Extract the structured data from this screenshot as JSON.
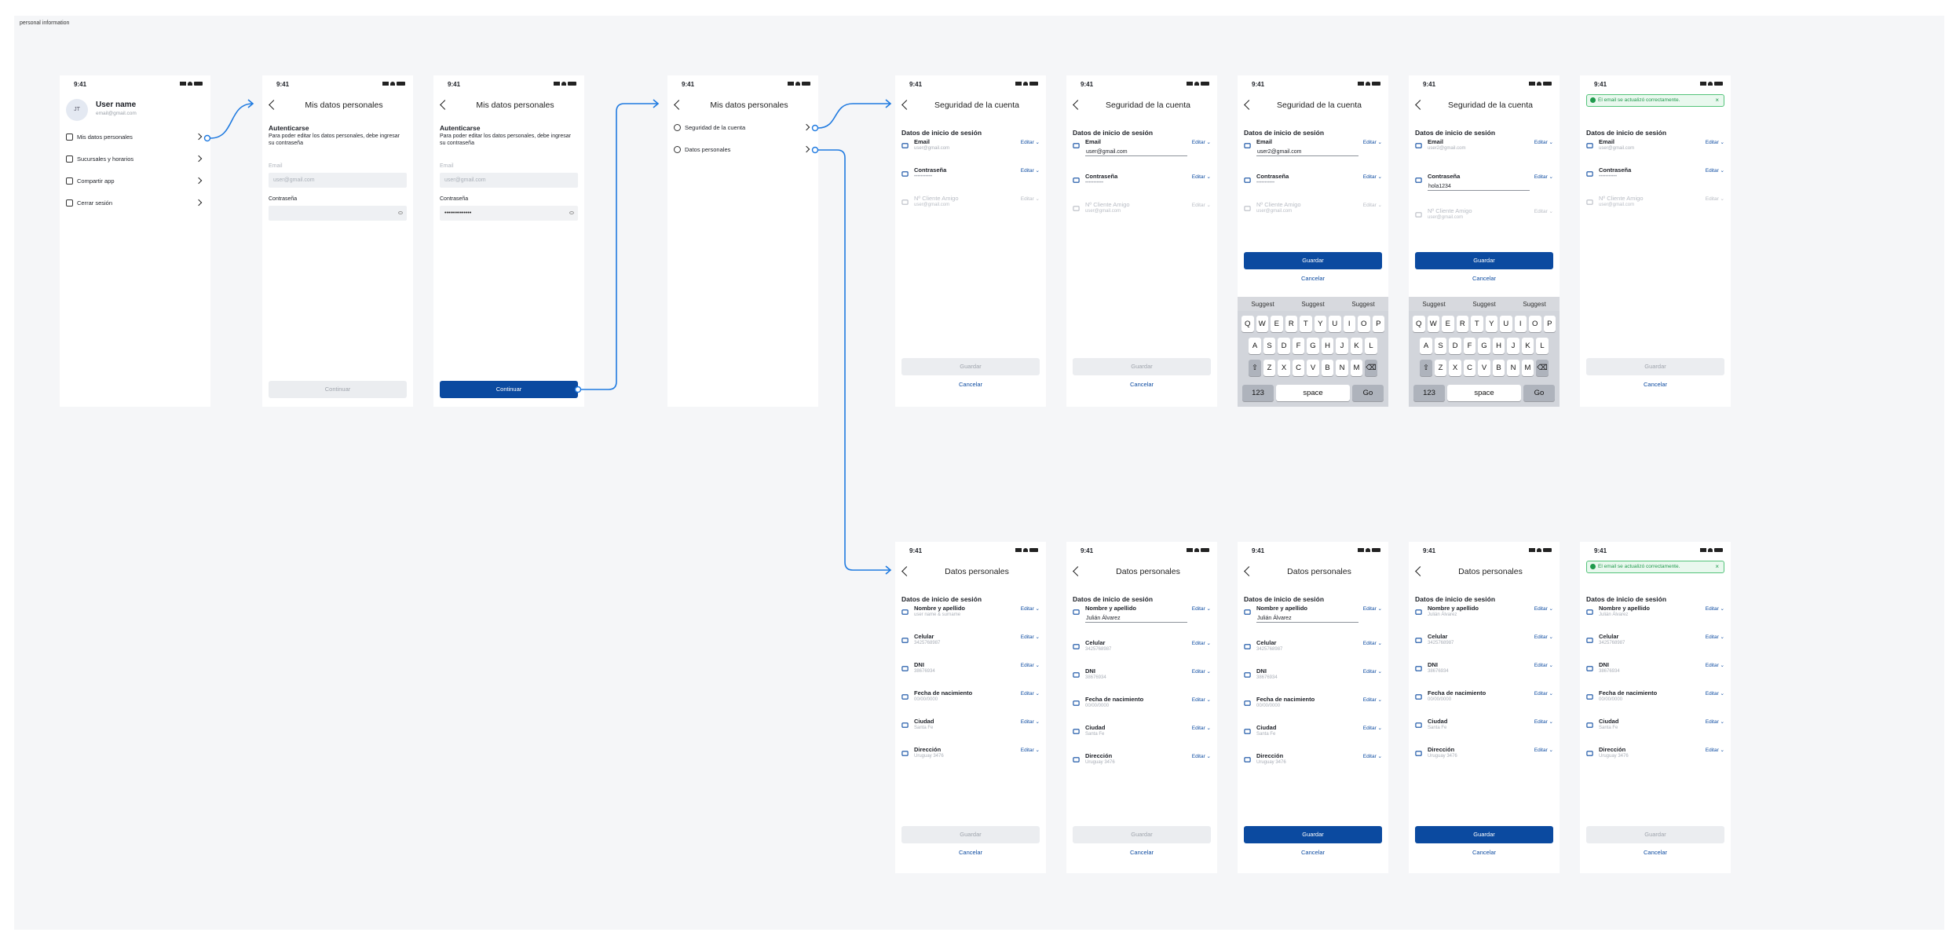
{
  "canvas_title": "personal information",
  "status_time": "9:41",
  "profile": {
    "avatar": "JT",
    "name": "User name",
    "email": "email@gmail.com",
    "menu": [
      "Mis datos personales",
      "Sucursales y horarios",
      "Compartir app",
      "Cerrar sesión"
    ]
  },
  "auth": {
    "title": "Mis datos personales",
    "heading": "Autenticarse",
    "desc": "Para poder editar los datos personales, debe ingresar su contraseña",
    "email_label": "Email",
    "email_placeholder": "user@gmail.com",
    "password_label": "Contraseña",
    "password_value": "••••••••••••••",
    "continue": "Continuar"
  },
  "datos_menu": {
    "title": "Mis datos personales",
    "items": [
      "Seguridad de la cuenta",
      "Datos personales"
    ]
  },
  "security": {
    "title": "Seguridad de la cuenta",
    "section": "Datos de inicio de sesión",
    "fields": [
      "Email",
      "Contraseña",
      "Nº Cliente Amigo"
    ],
    "values": [
      "user@gmail.com",
      "•••••••••••",
      "user@gmail.com"
    ],
    "edit": "Editar",
    "email_edit_1": "user@gmail.com",
    "email_edit_2": "user2@gmail.com",
    "password_edit": "hola1234",
    "save": "Guardar",
    "cancel": "Cancelar",
    "toast": "El email se actualizó correctamente."
  },
  "personal": {
    "title": "Datos personales",
    "section": "Datos de inicio de sesión",
    "fields": [
      "Nombre y apellido",
      "Celular",
      "DNI",
      "Fecha de nacimiento",
      "Ciudad",
      "Dirección"
    ],
    "values": [
      "user name & surname",
      "3425768987",
      "38676934",
      "00/00/0000",
      "Santa Fe",
      "Uruguay 3476"
    ],
    "name_edit_1": "Julián Álvarez",
    "name_edit_2": "Julián Álvarez",
    "name_value_saved": "Julián Álvarez",
    "edit": "Editar",
    "save": "Guardar",
    "cancel": "Cancelar",
    "toast": "El email se actualizó correctamente."
  },
  "keyboard": {
    "suggest": "Suggest",
    "row1": [
      "Q",
      "W",
      "E",
      "R",
      "T",
      "Y",
      "U",
      "I",
      "O",
      "P"
    ],
    "row2": [
      "A",
      "S",
      "D",
      "F",
      "G",
      "H",
      "J",
      "K",
      "L"
    ],
    "row3": [
      "Z",
      "X",
      "C",
      "V",
      "B",
      "N",
      "M"
    ],
    "num": "123",
    "space": "space",
    "go": "Go"
  },
  "colors": {
    "primary": "#0b4aa0",
    "connector": "#1f7ae0",
    "success": "#1f9a4c"
  }
}
